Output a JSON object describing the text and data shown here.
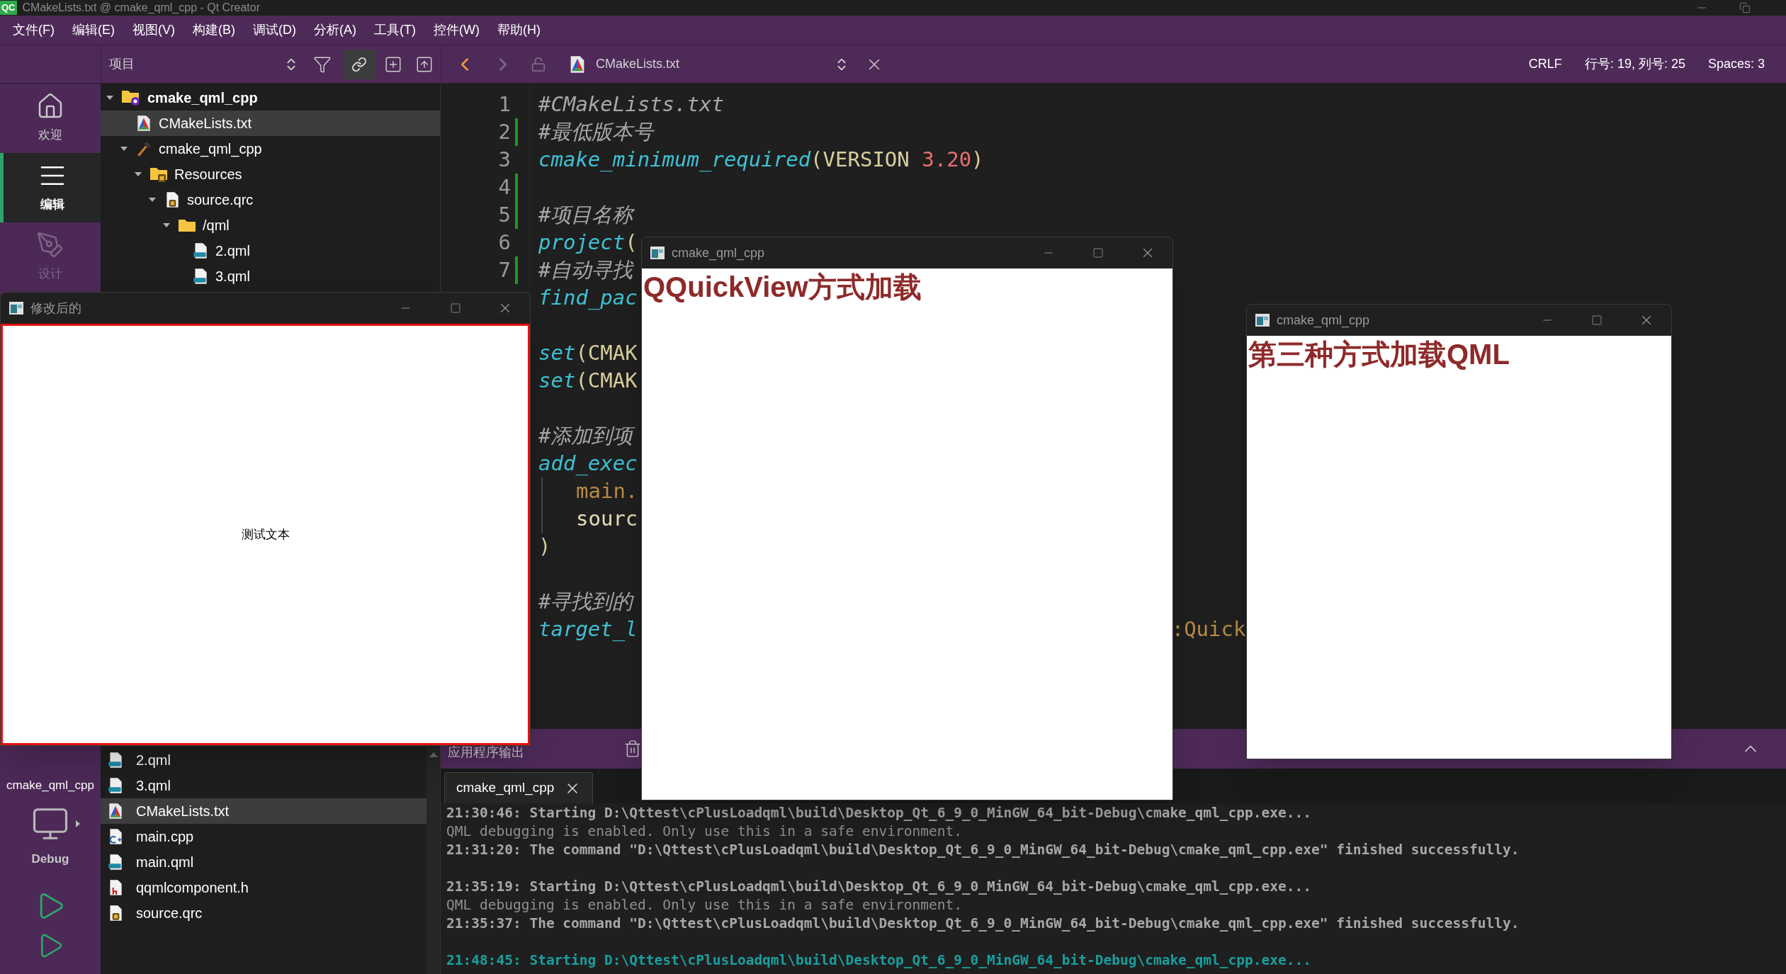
{
  "title_bar": {
    "logo": "QC",
    "title": "CMakeLists.txt @ cmake_qml_cpp - Qt Creator"
  },
  "menu": [
    "文件(F)",
    "编辑(E)",
    "视图(V)",
    "构建(B)",
    "调试(D)",
    "分析(A)",
    "工具(T)",
    "控件(W)",
    "帮助(H)"
  ],
  "toolbar": {
    "project_label": "项目",
    "link_on": true,
    "back_enabled": true,
    "forward_enabled": false,
    "file_name": "CMakeLists.txt"
  },
  "status": {
    "line_ending": "CRLF",
    "position": "行号: 19, 列号: 25",
    "indent": "Spaces: 3"
  },
  "modes": [
    {
      "label": "欢迎",
      "kind": "home",
      "selected": false,
      "disabled": false
    },
    {
      "label": "编辑",
      "kind": "edit",
      "selected": true,
      "disabled": false
    },
    {
      "label": "设计",
      "kind": "design",
      "selected": false,
      "disabled": true
    }
  ],
  "kit": {
    "project": "cmake_qml_cpp",
    "config": "Debug"
  },
  "tree": [
    {
      "name": "cmake_qml_cpp",
      "kind": "project",
      "expanded": true,
      "selected": false,
      "children": [
        {
          "name": "CMakeLists.txt",
          "kind": "cmake",
          "selected": true
        },
        {
          "name": "cmake_qml_cpp",
          "kind": "target",
          "expanded": true,
          "selected": false,
          "children": [
            {
              "name": "Resources",
              "kind": "qrc-folder",
              "expanded": true,
              "selected": false,
              "children": [
                {
                  "name": "source.qrc",
                  "kind": "qrc",
                  "expanded": true,
                  "selected": false,
                  "children": [
                    {
                      "name": "/qml",
                      "kind": "folder",
                      "expanded": true,
                      "selected": false,
                      "children": [
                        {
                          "name": "2.qml",
                          "kind": "qml",
                          "selected": false
                        },
                        {
                          "name": "3.qml",
                          "kind": "qml",
                          "selected": false
                        }
                      ]
                    }
                  ]
                }
              ]
            }
          ]
        }
      ]
    }
  ],
  "open_documents": [
    {
      "name": "2.qml",
      "kind": "qml",
      "selected": false
    },
    {
      "name": "3.qml",
      "kind": "qml",
      "selected": false
    },
    {
      "name": "CMakeLists.txt",
      "kind": "cmake",
      "selected": true
    },
    {
      "name": "main.cpp",
      "kind": "cpp",
      "selected": false
    },
    {
      "name": "main.qml",
      "kind": "qml",
      "selected": false
    },
    {
      "name": "qqmlcomponent.h",
      "kind": "header",
      "selected": false
    },
    {
      "name": "source.qrc",
      "kind": "qrc",
      "selected": false
    }
  ],
  "editor": {
    "lines": [
      {
        "kind": "code",
        "number": "1",
        "modified": false,
        "segments": [
          {
            "text": "#CMakeLists.txt",
            "kind": "comment"
          }
        ]
      },
      {
        "kind": "code",
        "number": "2",
        "modified": true,
        "segments": [
          {
            "text": "#最低版本号",
            "kind": "comment"
          }
        ]
      },
      {
        "kind": "code",
        "number": "3",
        "modified": false,
        "segments": [
          {
            "text": "cmake_minimum_required",
            "kind": "func"
          },
          {
            "text": "(VERSION ",
            "kind": "arg"
          },
          {
            "text": "3.20",
            "kind": "number"
          },
          {
            "text": ")",
            "kind": "arg"
          }
        ]
      },
      {
        "kind": "blank",
        "number": "4",
        "modified": true
      },
      {
        "kind": "code",
        "number": "5",
        "modified": true,
        "segments": [
          {
            "text": "#项目名称",
            "kind": "comment"
          }
        ]
      },
      {
        "kind": "code",
        "number": "6",
        "modified": false,
        "segments": [
          {
            "text": "project",
            "kind": "func"
          },
          {
            "text": "(",
            "kind": "arg"
          }
        ]
      },
      {
        "kind": "code",
        "number": "7",
        "modified": true,
        "segments": [
          {
            "text": "#自动寻找",
            "kind": "comment"
          }
        ]
      },
      {
        "kind": "code",
        "segments": [
          {
            "text": "find_pac",
            "kind": "func"
          }
        ]
      },
      {
        "kind": "blank"
      },
      {
        "kind": "code",
        "segments": [
          {
            "text": "set",
            "kind": "func"
          },
          {
            "text": "(CMAK",
            "kind": "arg"
          }
        ]
      },
      {
        "kind": "code",
        "segments": [
          {
            "text": "set",
            "kind": "func"
          },
          {
            "text": "(CMAK",
            "kind": "arg"
          }
        ]
      },
      {
        "kind": "blank"
      },
      {
        "kind": "code",
        "segments": [
          {
            "text": "#添加到项",
            "kind": "comment"
          }
        ]
      },
      {
        "kind": "code",
        "segments": [
          {
            "text": "add_exec",
            "kind": "func"
          }
        ]
      },
      {
        "kind": "code",
        "indented": true,
        "segments": [
          {
            "text": "main.",
            "kind": "file"
          }
        ]
      },
      {
        "kind": "code",
        "indented": true,
        "segments": [
          {
            "text": "sourc",
            "kind": "plain"
          }
        ]
      },
      {
        "kind": "code",
        "segments": [
          {
            "text": ")",
            "kind": "arg"
          }
        ]
      },
      {
        "kind": "blank"
      },
      {
        "kind": "code",
        "segments": [
          {
            "text": "#寻找到的",
            "kind": "comment"
          }
        ]
      },
      {
        "kind": "code",
        "segments": [
          {
            "text": "target_l",
            "kind": "func"
          },
          {
            "text": ":Quick",
            "kind": "file",
            "gap_before": true
          }
        ]
      }
    ]
  },
  "output": {
    "title": "应用程序输出",
    "tabs": [
      {
        "label": "cmake_qml_cpp",
        "selected": true
      }
    ],
    "lines": [
      {
        "kind": "bold",
        "text": "21:30:46: Starting D:\\Qttest\\cPlusLoadqml\\build\\Desktop_Qt_6_9_0_MinGW_64_bit-Debug\\cmake_qml_cpp.exe..."
      },
      {
        "kind": "normal",
        "text": "QML debugging is enabled. Only use this in a safe environment."
      },
      {
        "kind": "bold",
        "text": "21:31:20: The command \"D:\\Qttest\\cPlusLoadqml\\build\\Desktop_Qt_6_9_0_MinGW_64_bit-Debug\\cmake_qml_cpp.exe\" finished successfully."
      },
      {
        "kind": "blank"
      },
      {
        "kind": "bold",
        "text": "21:35:19: Starting D:\\Qttest\\cPlusLoadqml\\build\\Desktop_Qt_6_9_0_MinGW_64_bit-Debug\\cmake_qml_cpp.exe..."
      },
      {
        "kind": "normal",
        "text": "QML debugging is enabled. Only use this in a safe environment."
      },
      {
        "kind": "bold",
        "text": "21:35:37: The command \"D:\\Qttest\\cPlusLoadqml\\build\\Desktop_Qt_6_9_0_MinGW_64_bit-Debug\\cmake_qml_cpp.exe\" finished successfully."
      },
      {
        "kind": "blank"
      },
      {
        "kind": "highlight",
        "text": "21:48:45: Starting D:\\Qttest\\cPlusLoadqml\\build\\Desktop_Qt_6_9_0_MinGW_64_bit-Debug\\cmake_qml_cpp.exe..."
      }
    ]
  },
  "windows": [
    {
      "title": "修改后的",
      "active": true,
      "kind": "centered",
      "text": "测试文本"
    },
    {
      "title": "cmake_qml_cpp",
      "active": false,
      "kind": "heading",
      "text": "QQuickView方式加载"
    },
    {
      "title": "cmake_qml_cpp",
      "active": false,
      "kind": "heading",
      "text": "第三种方式加载QML"
    }
  ]
}
